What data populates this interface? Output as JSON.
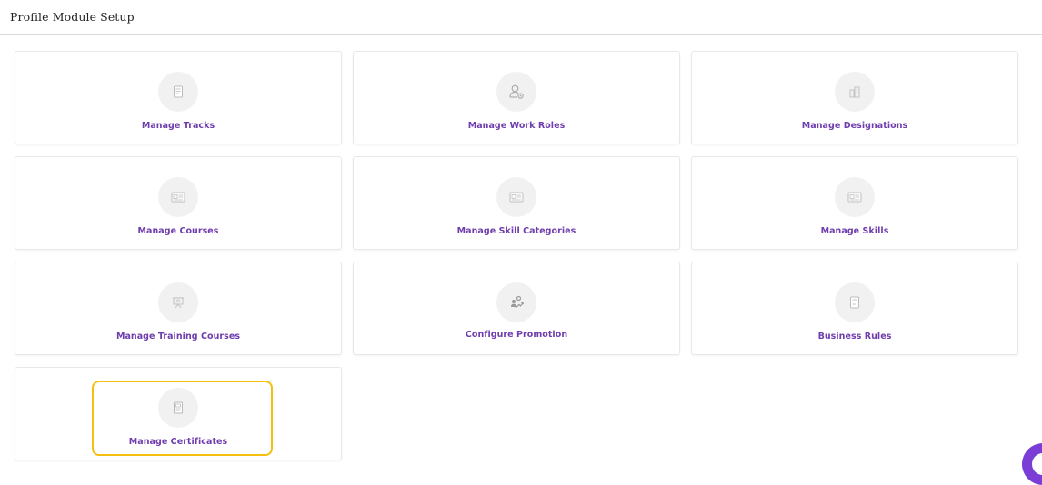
{
  "header": {
    "title": "Profile Module Setup"
  },
  "cards": [
    {
      "label": "Manage Tracks",
      "icon": "document-icon"
    },
    {
      "label": "Manage Work Roles",
      "icon": "user-settings-icon"
    },
    {
      "label": "Manage Designations",
      "icon": "buildings-icon"
    },
    {
      "label": "Manage Courses",
      "icon": "id-card-icon"
    },
    {
      "label": "Manage Skill Categories",
      "icon": "id-card-icon"
    },
    {
      "label": "Manage Skills",
      "icon": "id-card-icon"
    },
    {
      "label": "Manage Training Courses",
      "icon": "presentation-board-icon"
    },
    {
      "label": "Configure Promotion",
      "icon": "promotion-growth-icon"
    },
    {
      "label": "Business Rules",
      "icon": "document-icon"
    },
    {
      "label": "Manage Certificates",
      "icon": "certificate-icon"
    }
  ],
  "highlighted_card": "Manage Certificates",
  "colors": {
    "accent_text": "#6f3dad",
    "highlight_border": "#f4bf0f",
    "icon_circle": "#f1f1f1",
    "chat_button": "#7a3ed6"
  }
}
